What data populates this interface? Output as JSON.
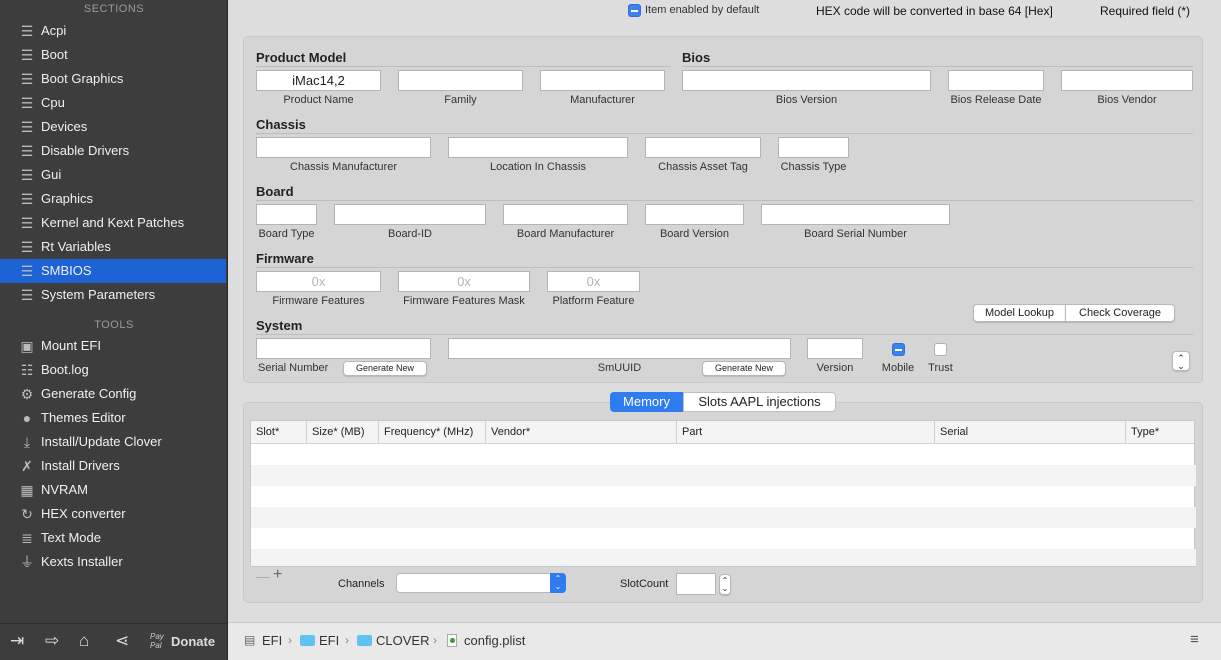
{
  "sidebar": {
    "sections_title": "SECTIONS",
    "sections": [
      {
        "label": "Acpi",
        "icon": "list-icon"
      },
      {
        "label": "Boot",
        "icon": "list-icon"
      },
      {
        "label": "Boot Graphics",
        "icon": "list-icon"
      },
      {
        "label": "Cpu",
        "icon": "list-icon"
      },
      {
        "label": "Devices",
        "icon": "list-icon"
      },
      {
        "label": "Disable Drivers",
        "icon": "list-icon"
      },
      {
        "label": "Gui",
        "icon": "list-icon"
      },
      {
        "label": "Graphics",
        "icon": "list-icon"
      },
      {
        "label": "Kernel and Kext Patches",
        "icon": "list-icon"
      },
      {
        "label": "Rt Variables",
        "icon": "list-icon"
      },
      {
        "label": "SMBIOS",
        "icon": "list-icon",
        "selected": true
      },
      {
        "label": "System Parameters",
        "icon": "list-icon"
      }
    ],
    "tools_title": "TOOLS",
    "tools": [
      {
        "label": "Mount EFI",
        "icon": "disk-icon"
      },
      {
        "label": "Boot.log",
        "icon": "log-search-icon"
      },
      {
        "label": "Generate Config",
        "icon": "gears-icon"
      },
      {
        "label": "Themes Editor",
        "icon": "palette-icon"
      },
      {
        "label": "Install/Update Clover",
        "icon": "download-icon"
      },
      {
        "label": "Install Drivers",
        "icon": "tools-icon"
      },
      {
        "label": "NVRAM",
        "icon": "chip-icon"
      },
      {
        "label": "HEX converter",
        "icon": "refresh-icon"
      },
      {
        "label": "Text Mode",
        "icon": "text-icon"
      },
      {
        "label": "Kexts Installer",
        "icon": "plug-icon"
      }
    ],
    "donate_label": "Donate",
    "paypal_label": "Pay Pal"
  },
  "top": {
    "item_enabled": "Item enabled by default",
    "hex_note": "HEX code will be converted in base 64 [Hex]",
    "required_note": "Required field (*)"
  },
  "product_model": {
    "title": "Product Model",
    "product_name_value": "iMac14,2",
    "product_name": "Product Name",
    "family": "Family",
    "manufacturer": "Manufacturer"
  },
  "bios": {
    "title": "Bios",
    "version": "Bios Version",
    "release_date": "Bios Release Date",
    "vendor": "Bios Vendor"
  },
  "chassis": {
    "title": "Chassis",
    "manufacturer": "Chassis Manufacturer",
    "location": "Location In Chassis",
    "asset_tag": "Chassis  Asset Tag",
    "type": "Chassis Type"
  },
  "board": {
    "title": "Board",
    "type": "Board Type",
    "id": "Board-ID",
    "manufacturer": "Board Manufacturer",
    "version": "Board Version",
    "serial": "Board Serial Number"
  },
  "firmware": {
    "title": "Firmware",
    "placeholder": "0x",
    "features": "Firmware Features",
    "features_mask": "Firmware Features Mask",
    "platform_feature": "Platform Feature"
  },
  "buttons": {
    "model_lookup": "Model Lookup",
    "check_coverage": "Check Coverage",
    "generate_new": "Generate New"
  },
  "system": {
    "title": "System",
    "serial": "Serial Number",
    "smuuid": "SmUUID",
    "version": "Version",
    "mobile": "Mobile",
    "trust": "Trust"
  },
  "tabs": {
    "memory": "Memory",
    "slots": "Slots AAPL injections"
  },
  "table": {
    "columns": [
      "Slot*",
      "Size* (MB)",
      "Frequency* (MHz)",
      "Vendor*",
      "Part",
      "Serial",
      "Type*"
    ]
  },
  "memory_footer": {
    "minus": "—",
    "plus": "+",
    "channels": "Channels",
    "slotcount": "SlotCount"
  },
  "breadcrumb": [
    "EFI",
    "EFI",
    "CLOVER",
    "config.plist"
  ]
}
